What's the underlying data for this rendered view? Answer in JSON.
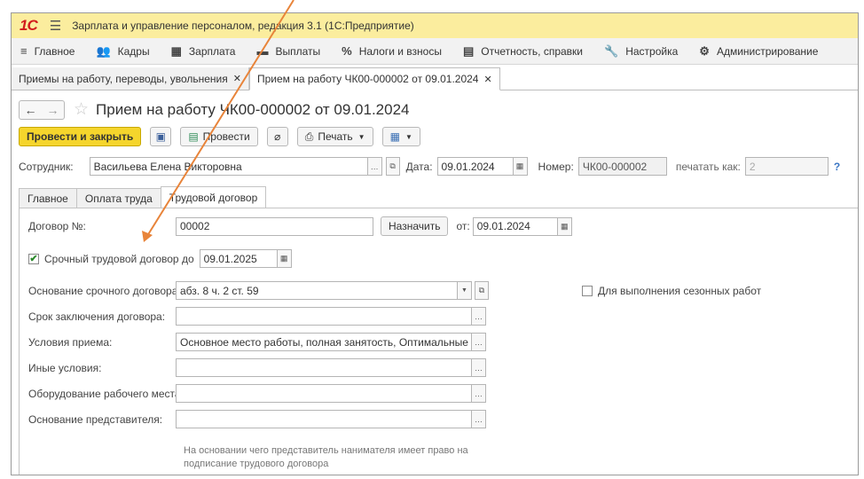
{
  "app": {
    "logo": "1С",
    "title": "Зарплата и управление персоналом, редакция 3.1  (1С:Предприятие)"
  },
  "menu": [
    {
      "icon": "≡",
      "label": "Главное"
    },
    {
      "icon": "👥",
      "label": "Кадры"
    },
    {
      "icon": "▦",
      "label": "Зарплата"
    },
    {
      "icon": "▬",
      "label": "Выплаты"
    },
    {
      "icon": "%",
      "label": "Налоги и взносы"
    },
    {
      "icon": "▤",
      "label": "Отчетность, справки"
    },
    {
      "icon": "🔧",
      "label": "Настройка"
    },
    {
      "icon": "⚙",
      "label": "Администрирование"
    }
  ],
  "open_tabs": [
    {
      "label": "Приемы на работу, переводы, увольнения"
    },
    {
      "label": "Прием на работу ЧК00-000002 от 09.01.2024"
    }
  ],
  "document": {
    "title": "Прием на работу ЧК00-000002 от 09.01.2024"
  },
  "toolbar": {
    "post_close": "Провести и закрыть",
    "post": "Провести",
    "print": "Печать"
  },
  "header": {
    "employee_label": "Сотрудник:",
    "employee_value": "Васильева Елена Викторовна",
    "date_label": "Дата:",
    "date_value": "09.01.2024",
    "number_label": "Номер:",
    "number_value": "ЧК00-000002",
    "print_as_label": "печатать как:",
    "print_as_placeholder": "2"
  },
  "form_tabs": [
    {
      "label": "Главное"
    },
    {
      "label": "Оплата труда"
    },
    {
      "label": "Трудовой договор"
    }
  ],
  "contract": {
    "number_label": "Договор №:",
    "number_value": "00002",
    "assign_button": "Назначить",
    "from_label": "от:",
    "from_value": "09.01.2024",
    "fixed_term_label": "Срочный трудовой договор до",
    "fixed_term_checked": true,
    "fixed_term_date": "09.01.2025",
    "basis_label": "Основание срочного договора:",
    "basis_value": "абз. 8 ч. 2 ст. 59",
    "seasonal_label": "Для выполнения сезонных работ",
    "seasonal_checked": false,
    "term_label": "Срок заключения договора:",
    "term_value": "",
    "conditions_label": "Условия приема:",
    "conditions_value": "Основное место работы, полная занятость, Оптимальные услов",
    "other_label": "Иные условия:",
    "other_value": "",
    "equipment_label": "Оборудование рабочего места:",
    "equipment_value": "",
    "representative_label": "Основание представителя:",
    "representative_value": "",
    "hint": "На основании чего представитель нанимателя имеет право на подписание трудового договора"
  },
  "colors": {
    "title_bar": "#fbed9e",
    "primary_button": "#f5d52c",
    "annotation_arrow": "#e8843a"
  }
}
